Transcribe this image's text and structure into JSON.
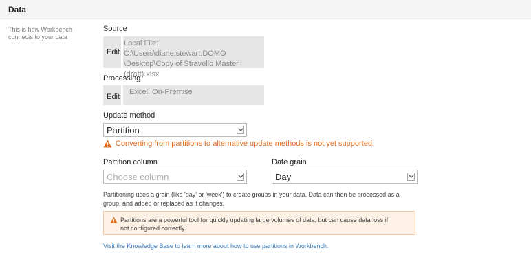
{
  "header": {
    "title": "Data"
  },
  "side": {
    "description": "This is how Workbench connects to your data"
  },
  "source": {
    "heading": "Source",
    "edit_label": "Edit",
    "lines": [
      "Local File: C:\\Users\\diane.stewart.DOMO",
      "\\Desktop\\Copy of Stravello Master",
      "(draft).xlsx"
    ]
  },
  "processing": {
    "heading": "Processing",
    "edit_label": "Edit",
    "value": "Excel: On-Premise"
  },
  "update_method": {
    "heading": "Update method",
    "selected": "Partition",
    "warning": "Converting from partitions to alternative update methods is not yet supported."
  },
  "partition_column": {
    "heading": "Partition column",
    "placeholder": "Choose column"
  },
  "date_grain": {
    "heading": "Date grain",
    "selected": "Day"
  },
  "help_text": "Partitioning uses a grain (like 'day' or 'week') to create groups in your data. Data can then be processed as a group, and added or replaced as it changes.",
  "alert": {
    "text": "Partitions are a powerful tool for quickly updating large volumes of data, but can cause data loss if not configured correctly."
  },
  "kb_link": "Visit the Knowledge Base to learn more about how to use partitions in Workbench.",
  "colors": {
    "warning": "#e06a1f",
    "link": "#3b7bb8",
    "alert_bg": "#fdf1e6"
  }
}
